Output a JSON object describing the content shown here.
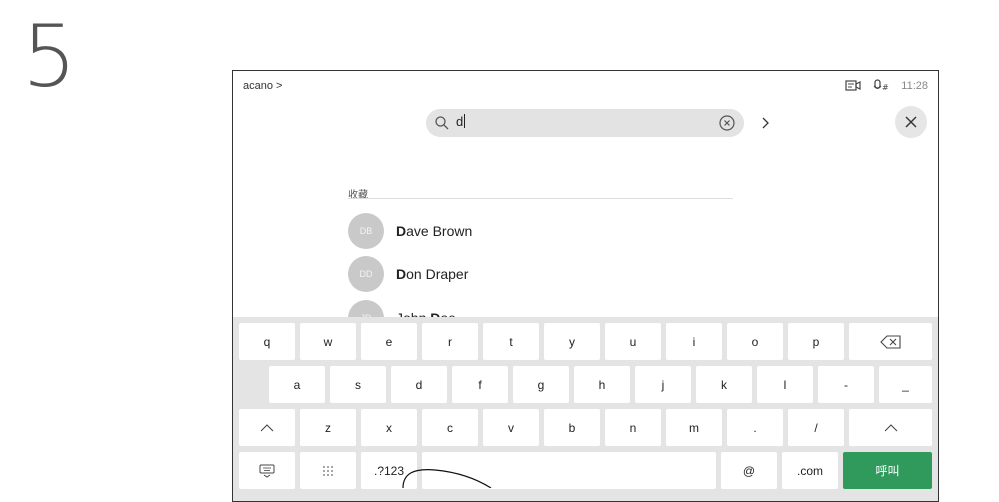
{
  "step_number": "5",
  "topbar": {
    "brand": "acano >",
    "time": "11:28"
  },
  "search": {
    "query": "d"
  },
  "favorites": {
    "header": "收藏",
    "contacts": [
      {
        "initials": "DB",
        "bold": "D",
        "rest": "ave Brown"
      },
      {
        "initials": "DD",
        "bold": "D",
        "rest": "on Draper"
      },
      {
        "initials": "JD",
        "pre": "John ",
        "bold": "D",
        "rest": "oe"
      }
    ]
  },
  "keyboard": {
    "row1": [
      "q",
      "w",
      "e",
      "r",
      "t",
      "y",
      "u",
      "i",
      "o",
      "p"
    ],
    "row2": [
      "a",
      "s",
      "d",
      "f",
      "g",
      "h",
      "j",
      "k",
      "l",
      "-",
      "_"
    ],
    "row3": [
      "z",
      "x",
      "c",
      "v",
      "b",
      "n",
      "m",
      ".",
      "/"
    ],
    "row4": {
      "symbols_label": ".?123",
      "at_label": "@",
      "com_label": ".com",
      "call_label": "呼叫"
    }
  },
  "colors": {
    "call_button": "#2f9a5c",
    "keyboard_bg": "#e4e4e4",
    "avatar_bg": "#c9c9c9"
  }
}
